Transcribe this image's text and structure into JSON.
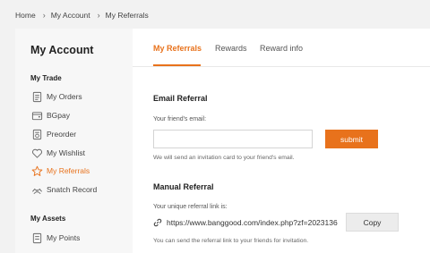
{
  "breadcrumb": {
    "items": [
      "Home",
      "My Account",
      "My Referrals"
    ],
    "separator": "›"
  },
  "sidebar": {
    "title": "My Account",
    "sections": [
      {
        "title": "My Trade",
        "items": [
          {
            "label": "My Orders",
            "icon": "orders-icon"
          },
          {
            "label": "BGpay",
            "icon": "wallet-icon"
          },
          {
            "label": "Preorder",
            "icon": "preorder-icon"
          },
          {
            "label": "My Wishlist",
            "icon": "heart-icon"
          },
          {
            "label": "My Referrals",
            "icon": "star-icon",
            "active": true
          },
          {
            "label": "Snatch Record",
            "icon": "hands-icon"
          }
        ]
      },
      {
        "title": "My Assets",
        "items": [
          {
            "label": "My Points",
            "icon": "points-icon"
          }
        ]
      }
    ]
  },
  "tabs": [
    {
      "label": "My Referrals",
      "active": true
    },
    {
      "label": "Rewards"
    },
    {
      "label": "Reward info"
    }
  ],
  "email_referral": {
    "heading": "Email Referral",
    "field_label": "Your friend's email:",
    "value": "",
    "submit_label": "submit",
    "note": "We will send an invitation card to your friend's email."
  },
  "manual_referral": {
    "heading": "Manual Referral",
    "link_label": "Your unique referral link is:",
    "link": "https://www.banggood.com/index.php?zf=2023136",
    "copy_label": "Copy",
    "note": "You can send the referral link to your friends for invitation."
  },
  "colors": {
    "accent": "#e8721c",
    "sidebar_bg": "#f7f7f7",
    "page_bg": "#f2f2f2"
  }
}
